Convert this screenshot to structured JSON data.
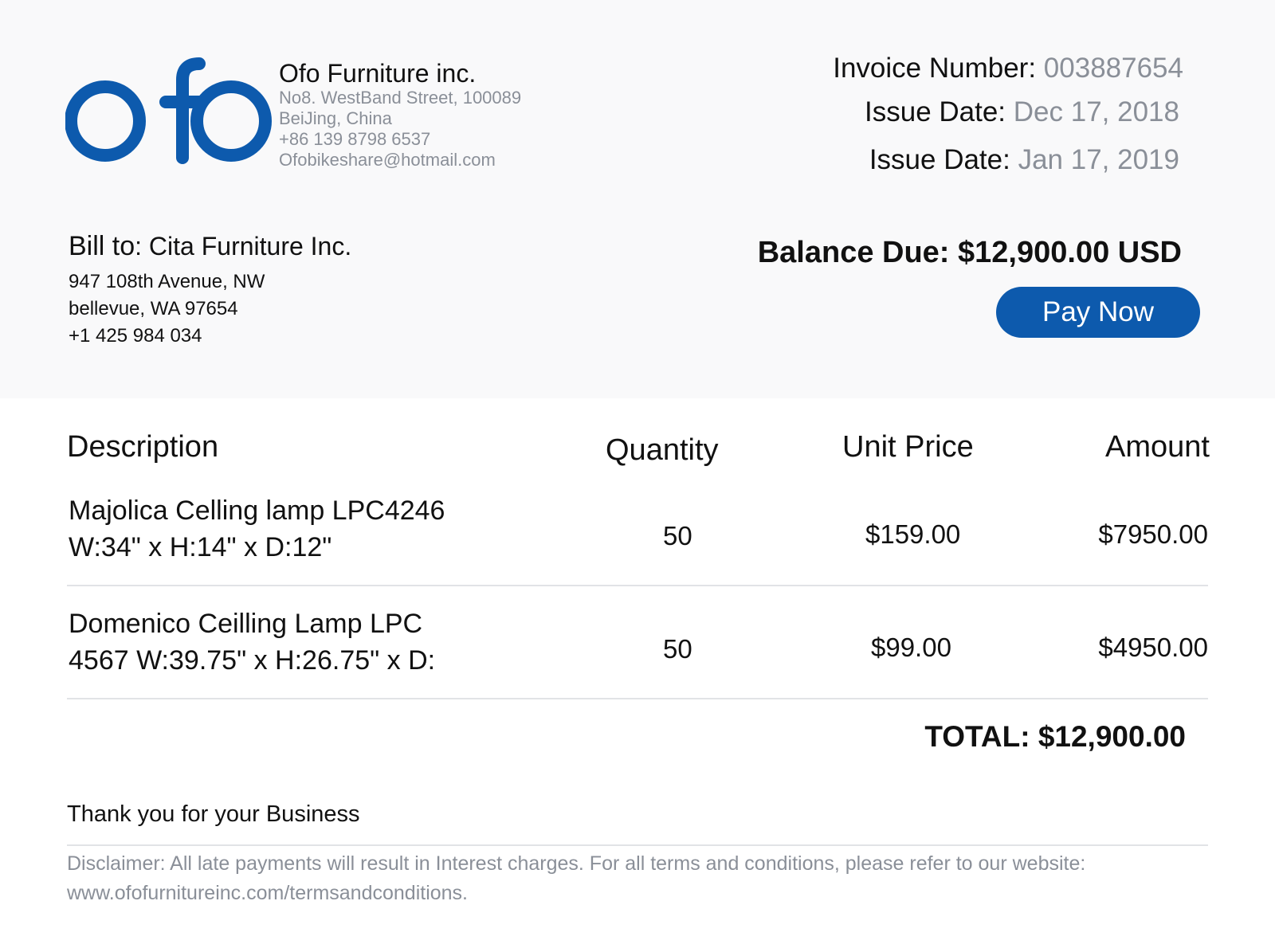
{
  "company": {
    "logo_text": "ofo",
    "name": "Ofo Furniture inc.",
    "address_line1": "No8. WestBand Street, 100089",
    "address_line2": "BeiJing, China",
    "phone": "+86 139 8798 6537",
    "email": "Ofobikeshare@hotmail.com"
  },
  "invoice": {
    "number_label": "Invoice Number:",
    "number": "003887654",
    "issue_label": "Issue Date:",
    "issue_date": "Dec 17, 2018",
    "due_label": "Issue Date:",
    "due_date": "Jan 17, 2019"
  },
  "bill_to": {
    "label": "Bill to",
    "name": ": Cita Furniture Inc.",
    "line1": "947 108th Avenue, NW",
    "line2": "bellevue, WA 97654",
    "phone": "+1 425 984 034"
  },
  "balance": {
    "text": "Balance Due: $12,900.00 USD",
    "pay_button": "Pay Now"
  },
  "table": {
    "headers": {
      "description": "Description",
      "quantity": "Quantity",
      "unit_price": "Unit Price",
      "amount": "Amount"
    },
    "rows": [
      {
        "desc_line1": "Majolica Celling lamp LPC4246",
        "desc_line2": "W:34\" x H:14\" x D:12\"",
        "quantity": "50",
        "unit_price": "$159.00",
        "amount": "$7950.00"
      },
      {
        "desc_line1": "Domenico Ceilling Lamp LPC",
        "desc_line2": "4567 W:39.75\" x H:26.75\" x D:",
        "quantity": "50",
        "unit_price": "$99.00",
        "amount": "$4950.00"
      }
    ]
  },
  "total": "TOTAL: $12,900.00",
  "footer": {
    "thanks": "Thank you for your Business",
    "disclaimer": "Disclaimer: All late payments will result in Interest charges. For all terms and conditions, please refer to our website: www.ofofurnitureinc.com/termsandconditions."
  },
  "colors": {
    "brand_blue": "#0d5aad",
    "muted_text": "#8a8f98",
    "header_bg": "#f9f9fa"
  }
}
